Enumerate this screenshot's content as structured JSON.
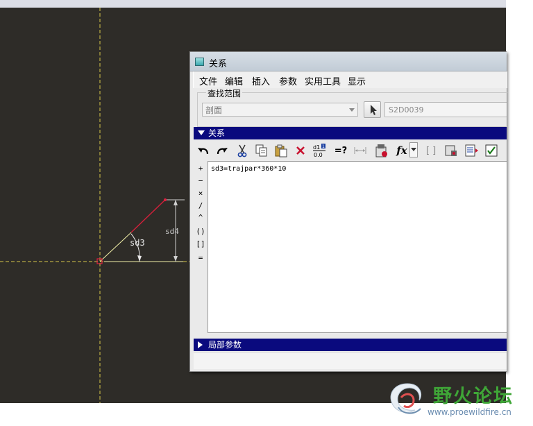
{
  "dialog": {
    "title": "关系",
    "menu": [
      "文件",
      "编辑",
      "插入",
      "参数",
      "实用工具",
      "显示"
    ],
    "search": {
      "legend": "查找范围",
      "scope_value": "剖面",
      "pick_field_value": "S2D0039"
    },
    "relations_section": "关系",
    "editor_text": "sd3=trajpar*360*10",
    "operators": [
      "+",
      "−",
      "×",
      "/",
      "^",
      "()",
      "[]",
      "="
    ],
    "local_params_section": "局部参数",
    "toolbar": {
      "fx_label": "fx",
      "eq_check_label": "=?",
      "dims_top": "d1",
      "dims_sup": "1",
      "dims_bottom": "0.0",
      "brackets_label": "[ ]"
    }
  },
  "sketch": {
    "angle_dim_label": "sd3",
    "length_dim_label": "sd4"
  },
  "watermark": {
    "name": "野火论坛",
    "url": "www.proewildfire.cn"
  }
}
